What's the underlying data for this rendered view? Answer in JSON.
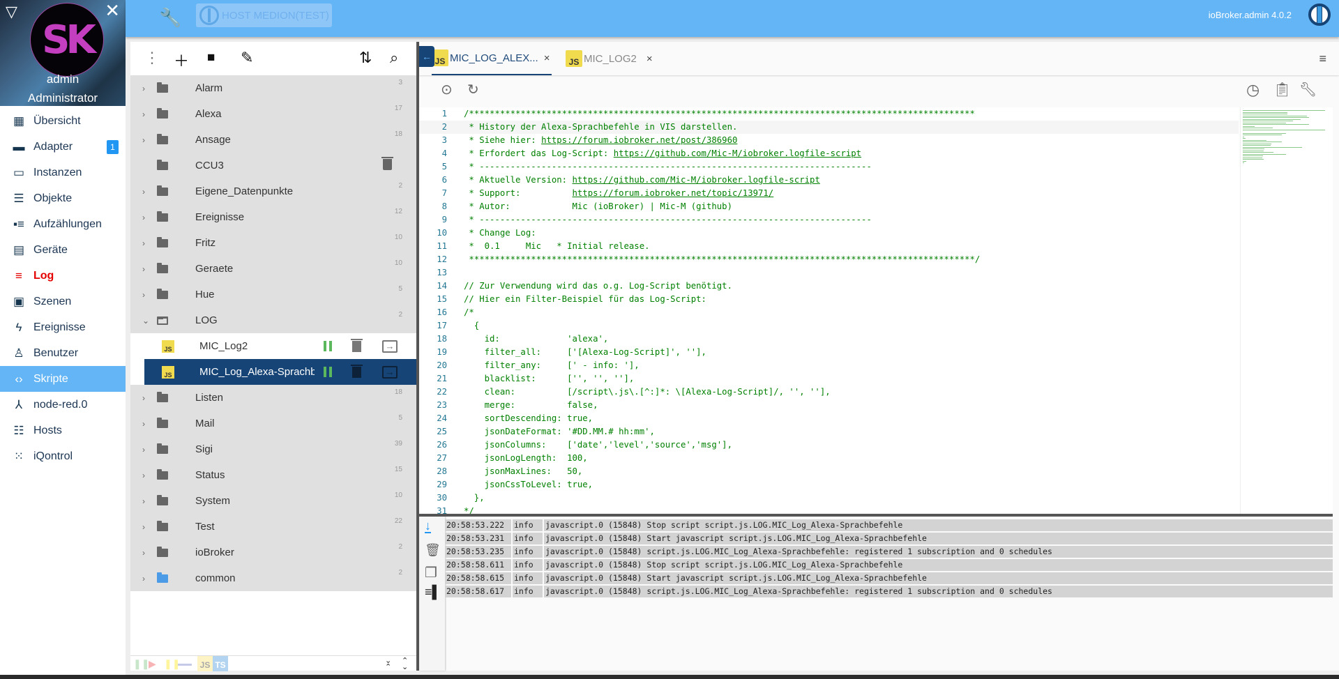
{
  "drawer": {
    "user_name": "admin",
    "user_role": "Administrator",
    "avatar_text": "SK",
    "toggle_glyph": "▽",
    "close_glyph": "✕"
  },
  "nav": [
    {
      "label": "Übersicht",
      "icon": "grid-icon",
      "glyph": "▦"
    },
    {
      "label": "Adapter",
      "icon": "store-icon",
      "glyph": "▬",
      "badge": "1"
    },
    {
      "label": "Instanzen",
      "icon": "instances-icon",
      "glyph": "▭"
    },
    {
      "label": "Objekte",
      "icon": "list-icon",
      "glyph": "☰"
    },
    {
      "label": "Aufzählungen",
      "icon": "enum-icon",
      "glyph": "▪≡"
    },
    {
      "label": "Geräte",
      "icon": "devices-icon",
      "glyph": "▤"
    },
    {
      "label": "Log",
      "icon": "log-icon",
      "glyph": "≡"
    },
    {
      "label": "Szenen",
      "icon": "scenes-icon",
      "glyph": "▣"
    },
    {
      "label": "Ereignisse",
      "icon": "lightning-icon",
      "glyph": "ϟ"
    },
    {
      "label": "Benutzer",
      "icon": "user-icon",
      "glyph": "♙"
    },
    {
      "label": "Skripte",
      "icon": "code-icon",
      "glyph": "‹›"
    },
    {
      "label": "node-red.0",
      "icon": "node-red-icon",
      "glyph": "⅄"
    },
    {
      "label": "Hosts",
      "icon": "hosts-icon",
      "glyph": "☷"
    },
    {
      "label": "iQontrol",
      "icon": "iqontrol-icon",
      "glyph": "⁙"
    }
  ],
  "header": {
    "host_label": "HOST MEDION(TEST)",
    "version": "ioBroker.admin 4.0.2"
  },
  "tree": {
    "folders_top": [
      {
        "name": "Alarm",
        "count": "3"
      },
      {
        "name": "Alexa",
        "count": "17"
      },
      {
        "name": "Ansage",
        "count": "18"
      },
      {
        "name": "CCU3",
        "count": ""
      },
      {
        "name": "Eigene_Datenpunkte",
        "count": "2"
      },
      {
        "name": "Ereignisse",
        "count": "12"
      },
      {
        "name": "Fritz",
        "count": "10"
      },
      {
        "name": "Geraete",
        "count": "10"
      },
      {
        "name": "Hue",
        "count": "5"
      },
      {
        "name": "LOG",
        "count": "2"
      }
    ],
    "scripts": [
      {
        "name": "MIC_Log2",
        "badge": "JS"
      },
      {
        "name": "MIC_Log_Alexa-Sprachbefehle",
        "badge": "JS"
      }
    ],
    "folders_bottom": [
      {
        "name": "Listen",
        "count": "18"
      },
      {
        "name": "Mail",
        "count": "5"
      },
      {
        "name": "Sigi",
        "count": "39"
      },
      {
        "name": "Status",
        "count": "15"
      },
      {
        "name": "System",
        "count": "10"
      },
      {
        "name": "Test",
        "count": "22"
      },
      {
        "name": "ioBroker",
        "count": "2"
      },
      {
        "name": "common",
        "count": "2"
      }
    ],
    "footer_filters": [
      "JS",
      "TS"
    ]
  },
  "editor": {
    "tabs": [
      {
        "label": "MIC_LOG_ALEX...",
        "badge": "JS"
      },
      {
        "label": "MIC_LOG2",
        "badge": "JS"
      }
    ],
    "code_lines": [
      "/**************************************************************************************************",
      " * History der Alexa-Sprachbefehle in VIS darstellen.",
      " * Siehe hier: https://forum.iobroker.net/post/386960",
      " * Erfordert das Log-Script: https://github.com/Mic-M/iobroker.logfile-script",
      " * ----------------------------------------------------------------------------",
      " * Aktuelle Version: https://github.com/Mic-M/iobroker.logfile-script",
      " * Support:          https://forum.iobroker.net/topic/13971/",
      " * Autor:            Mic (ioBroker) | Mic-M (github)",
      " * ----------------------------------------------------------------------------",
      " * Change Log:",
      " *  0.1     Mic   * Initial release.",
      " **************************************************************************************************/",
      "",
      "// Zur Verwendung wird das o.g. Log-Script benötigt.",
      "// Hier ein Filter-Beispiel für das Log-Script:",
      "/*",
      "  {",
      "    id:             'alexa',",
      "    filter_all:     ['[Alexa-Log-Script]', ''],",
      "    filter_any:     [' - info: '],",
      "    blacklist:      ['', '', ''],",
      "    clean:          [/script\\.js\\.[^:]*: \\[Alexa-Log-Script]/, '', ''],",
      "    merge:          false,",
      "    sortDescending: true,",
      "    jsonDateFormat: '#DD.MM.# hh:mm',",
      "    jsonColumns:    ['date','level','source','msg'],",
      "    jsonLogLength:  100,",
      "    jsonMaxLines:   50,",
      "    jsonCssToLevel: true,",
      "  },",
      "*/"
    ]
  },
  "log": [
    {
      "time": "20:58:53.222",
      "level": "info",
      "msg": "javascript.0 (15848) Stop script script.js.LOG.MIC_Log_Alexa-Sprachbefehle"
    },
    {
      "time": "20:58:53.231",
      "level": "info",
      "msg": "javascript.0 (15848) Start javascript script.js.LOG.MIC_Log_Alexa-Sprachbefehle"
    },
    {
      "time": "20:58:53.235",
      "level": "info",
      "msg": "javascript.0 (15848) script.js.LOG.MIC_Log_Alexa-Sprachbefehle: registered 1 subscription and 0 schedules"
    },
    {
      "time": "20:58:58.611",
      "level": "info",
      "msg": "javascript.0 (15848) Stop script script.js.LOG.MIC_Log_Alexa-Sprachbefehle"
    },
    {
      "time": "20:58:58.615",
      "level": "info",
      "msg": "javascript.0 (15848) Start javascript script.js.LOG.MIC_Log_Alexa-Sprachbefehle"
    },
    {
      "time": "20:58:58.617",
      "level": "info",
      "msg": "javascript.0 (15848) script.js.LOG.MIC_Log_Alexa-Sprachbefehle: registered 1 subscription and 0 schedules"
    }
  ]
}
